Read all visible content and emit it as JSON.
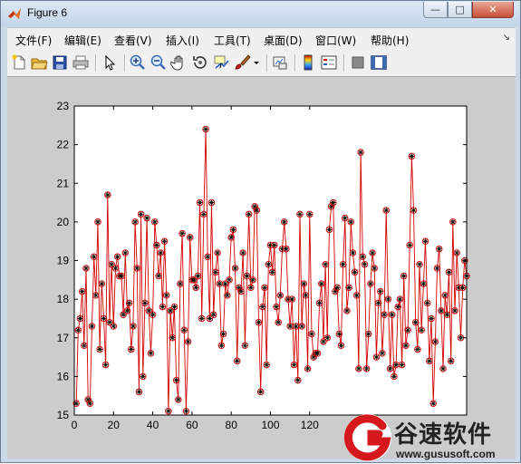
{
  "window": {
    "title": "Figure 6",
    "buttons": {
      "minimize": "—",
      "maximize": "□",
      "close": "✕"
    }
  },
  "menu": {
    "items": [
      "文件(F)",
      "编辑(E)",
      "查看(V)",
      "插入(I)",
      "工具(T)",
      "桌面(D)",
      "窗口(W)",
      "帮助(H)"
    ],
    "corner": "↘"
  },
  "toolbar": {
    "icons": [
      "new-figure-icon",
      "open-file-icon",
      "save-icon",
      "print-icon",
      "pointer-icon",
      "zoom-in-icon",
      "zoom-out-icon",
      "pan-hand-icon",
      "rotate-3d-icon",
      "data-cursor-icon",
      "brush-icon",
      "dropdown-arrow-icon",
      "link-plot-icon",
      "colorbar-icon",
      "legend-icon",
      "hide-plot-tools-icon",
      "show-plot-tools-icon"
    ]
  },
  "watermark": {
    "name": "谷速软件",
    "url": "www.gususoft.com"
  },
  "chart_data": {
    "type": "line",
    "title": "",
    "xlabel": "",
    "ylabel": "",
    "xlim": [
      0,
      200
    ],
    "ylim": [
      15,
      23
    ],
    "xticks": [
      0,
      20,
      40,
      60,
      80,
      100,
      120
    ],
    "yticks": [
      15,
      16,
      17,
      18,
      19,
      20,
      21,
      22,
      23
    ],
    "grid": false,
    "colors": {
      "line": "#d40000",
      "marker_circle": "#d40000",
      "marker_star": "#000000",
      "axes_bg": "#ffffff",
      "figure_bg": "#cccccc"
    },
    "series": [
      {
        "markers": [
          "circle",
          "star"
        ],
        "x": [
          1,
          2,
          3,
          4,
          5,
          6,
          7,
          8,
          9,
          10,
          11,
          12,
          13,
          14,
          15,
          16,
          17,
          18,
          19,
          20,
          21,
          22,
          23,
          24,
          25,
          26,
          27,
          28,
          29,
          30,
          31,
          32,
          33,
          34,
          35,
          36,
          37,
          38,
          39,
          40,
          41,
          42,
          43,
          44,
          45,
          46,
          47,
          48,
          49,
          50,
          51,
          52,
          53,
          54,
          55,
          56,
          57,
          58,
          59,
          60,
          61,
          62,
          63,
          64,
          65,
          66,
          67,
          68,
          69,
          70,
          71,
          72,
          73,
          74,
          75,
          76,
          77,
          78,
          79,
          80,
          81,
          82,
          83,
          84,
          85,
          86,
          87,
          88,
          89,
          90,
          91,
          92,
          93,
          94,
          95,
          96,
          97,
          98,
          99,
          100,
          101,
          102,
          103,
          104,
          105,
          106,
          107,
          108,
          109,
          110,
          111,
          112,
          113,
          114,
          115,
          116,
          117,
          118,
          119,
          120,
          121,
          122,
          123,
          124,
          125,
          126,
          127,
          128,
          129,
          130,
          131,
          132,
          133,
          134,
          135,
          136,
          137,
          138,
          139,
          140,
          141,
          142,
          143,
          144,
          145,
          146,
          147,
          148,
          149,
          150,
          151,
          152,
          153,
          154,
          155,
          156,
          157,
          158,
          159,
          160,
          161,
          162,
          163,
          164,
          165,
          166,
          167,
          168,
          169,
          170,
          171,
          172,
          173,
          174,
          175,
          176,
          177,
          178,
          179,
          180,
          181,
          182,
          183,
          184,
          185,
          186,
          187,
          188,
          189,
          190,
          191,
          192,
          193,
          194,
          195,
          196,
          197,
          198,
          199,
          200
        ],
        "y": [
          15.3,
          17.2,
          17.5,
          18.2,
          16.8,
          18.8,
          15.4,
          15.3,
          17.3,
          19.1,
          18.1,
          20.0,
          16.7,
          18.4,
          17.5,
          16.3,
          20.7,
          17.4,
          18.9,
          17.3,
          18.8,
          19.1,
          18.6,
          18.6,
          17.6,
          19.2,
          17.7,
          17.9,
          16.7,
          17.3,
          20.0,
          18.8,
          15.6,
          20.2,
          16.0,
          17.9,
          20.1,
          17.7,
          16.6,
          17.6,
          20.0,
          19.4,
          18.6,
          19.2,
          17.8,
          19.5,
          18.1,
          15.1,
          17.7,
          17.0,
          17.8,
          15.9,
          15.4,
          18.4,
          19.7,
          17.2,
          15.1,
          16.9,
          19.6,
          18.5,
          18.5,
          18.3,
          18.6,
          20.5,
          17.5,
          20.2,
          22.4,
          19.1,
          17.5,
          20.5,
          17.6,
          18.7,
          19.2,
          18.4,
          16.8,
          17.1,
          18.4,
          18.1,
          18.5,
          19.6,
          19.8,
          18.8,
          16.4,
          18.3,
          18.2,
          19.2,
          16.8,
          18.6,
          20.2,
          18.3,
          18.5,
          20.4,
          20.3,
          17.4,
          15.6,
          17.8,
          18.3,
          16.3,
          18.9,
          19.4,
          18.7,
          19.4,
          17.8,
          17.4,
          18.1,
          19.3,
          20.0,
          19.3,
          18.0,
          17.3,
          18.0,
          16.3,
          17.3,
          15.9,
          20.2,
          17.3,
          18.4,
          18.1,
          16.2,
          20.2,
          17.1,
          16.5,
          16.6,
          16.6,
          17.9,
          18.4,
          16.9,
          18.9,
          17.0,
          19.8,
          20.4,
          20.5,
          18.2,
          18.3,
          17.1,
          16.8,
          18.9,
          20.1,
          17.7,
          18.3,
          20.0,
          19.2,
          18.7,
          18.1,
          16.2,
          21.8,
          19.1,
          18.9,
          16.2,
          17.1,
          18.4,
          19.2,
          18.8,
          16.5,
          17.9,
          18.2,
          16.6,
          17.6,
          20.3,
          18.0,
          16.2,
          17.6,
          16.0,
          16.3,
          17.8,
          18.0,
          16.3,
          18.6,
          16.8,
          17.2,
          19.4,
          21.7,
          20.3,
          17.4,
          16.7,
          18.9,
          17.2,
          18.4,
          19.5,
          17.9,
          16.4,
          17.5,
          15.3,
          16.9,
          18.8,
          19.3,
          17.7,
          16.2,
          18.1,
          17.6,
          18.7,
          16.4,
          20.0,
          17.7,
          19.2,
          18.3,
          17.0,
          18.3,
          19.0,
          18.6
        ]
      }
    ]
  }
}
